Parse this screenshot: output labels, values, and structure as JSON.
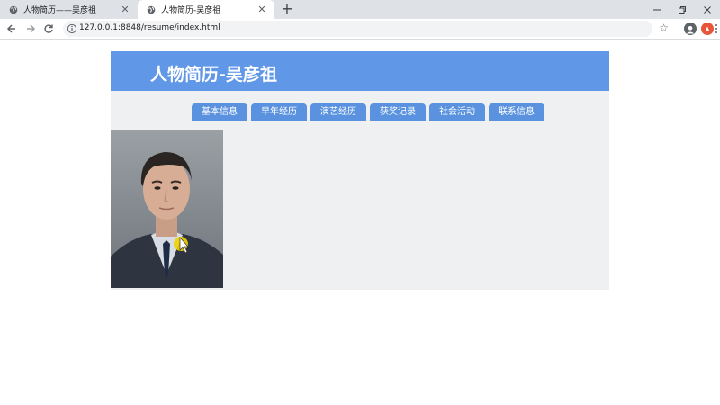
{
  "browser": {
    "tabs": [
      {
        "title": "人物简历——吴彦祖",
        "active": false
      },
      {
        "title": "人物简历-吴彦祖",
        "active": true
      }
    ],
    "new_tab_symbol": "+",
    "address": "127.0.0.1:8848/resume/index.html",
    "icons": [
      "back-arrow-icon",
      "forward-arrow-icon",
      "reload-icon",
      "info-icon",
      "star-icon",
      "profile-icon",
      "extension-icon",
      "menu-icon",
      "minimize-icon",
      "restore-icon",
      "close-icon"
    ]
  },
  "page": {
    "banner_title": "人物简历-吴彦祖",
    "nav": [
      "基本信息",
      "早年经历",
      "演艺经历",
      "获奖记录",
      "社会活动",
      "联系信息"
    ],
    "photo": {
      "subject": "portrait"
    }
  },
  "colors": {
    "banner": "#6097e6",
    "nav_button": "#5a92df",
    "content_bg": "#eff0f1",
    "tabstrip": "#dee1e6"
  }
}
